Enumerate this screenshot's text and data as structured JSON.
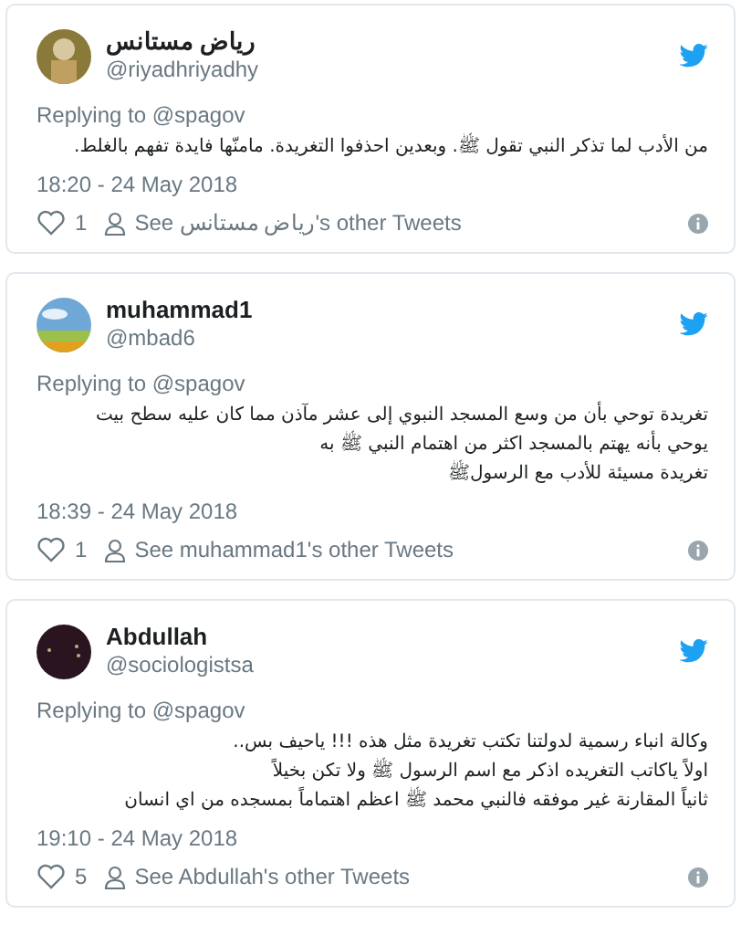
{
  "tweets": [
    {
      "name": "رياض مستانس",
      "handle": "@riyadhriyadhy",
      "replying_to": "Replying to @spagov",
      "body": [
        "من الأدب لما تذكر النبي تقول ﷺ. وبعدين احذفوا التغريدة. مامنّها فايدة تفهم بالغلط."
      ],
      "time": "18:20 - 24 May 2018",
      "likes": "1",
      "see_more": "See رياض مستانس's other Tweets"
    },
    {
      "name": "muhammad1",
      "handle": "@mbad6",
      "replying_to": "Replying to @spagov",
      "body": [
        "تغريدة توحي بأن من وسع المسجد النبوي إلى عشر مآذن مما كان عليه سطح بيت",
        "يوحي بأنه يهتم بالمسجد اكثر من اهتمام النبي ﷺ به",
        "تغريدة مسيئة للأدب مع الرسولﷺ"
      ],
      "time": "18:39 - 24 May 2018",
      "likes": "1",
      "see_more": "See muhammad1's other Tweets"
    },
    {
      "name": "Abdullah",
      "handle": "@sociologistsa",
      "replying_to": "Replying to @spagov",
      "body": [
        "وكالة انباء رسمية لدولتنا تكتب تغريدة مثل هذه !!! ياحيف بس..",
        "اولاً ياكاتب التغريده اذكر مع اسم الرسول ﷺ ولا تكن بخيلاً",
        "ثانياً المقارنة غير موفقه فالنبي محمد ﷺ اعظم اهتماماً بمسجده من اي انسان"
      ],
      "time": "19:10 - 24 May 2018",
      "likes": "5",
      "see_more": "See Abdullah's other Tweets"
    }
  ]
}
